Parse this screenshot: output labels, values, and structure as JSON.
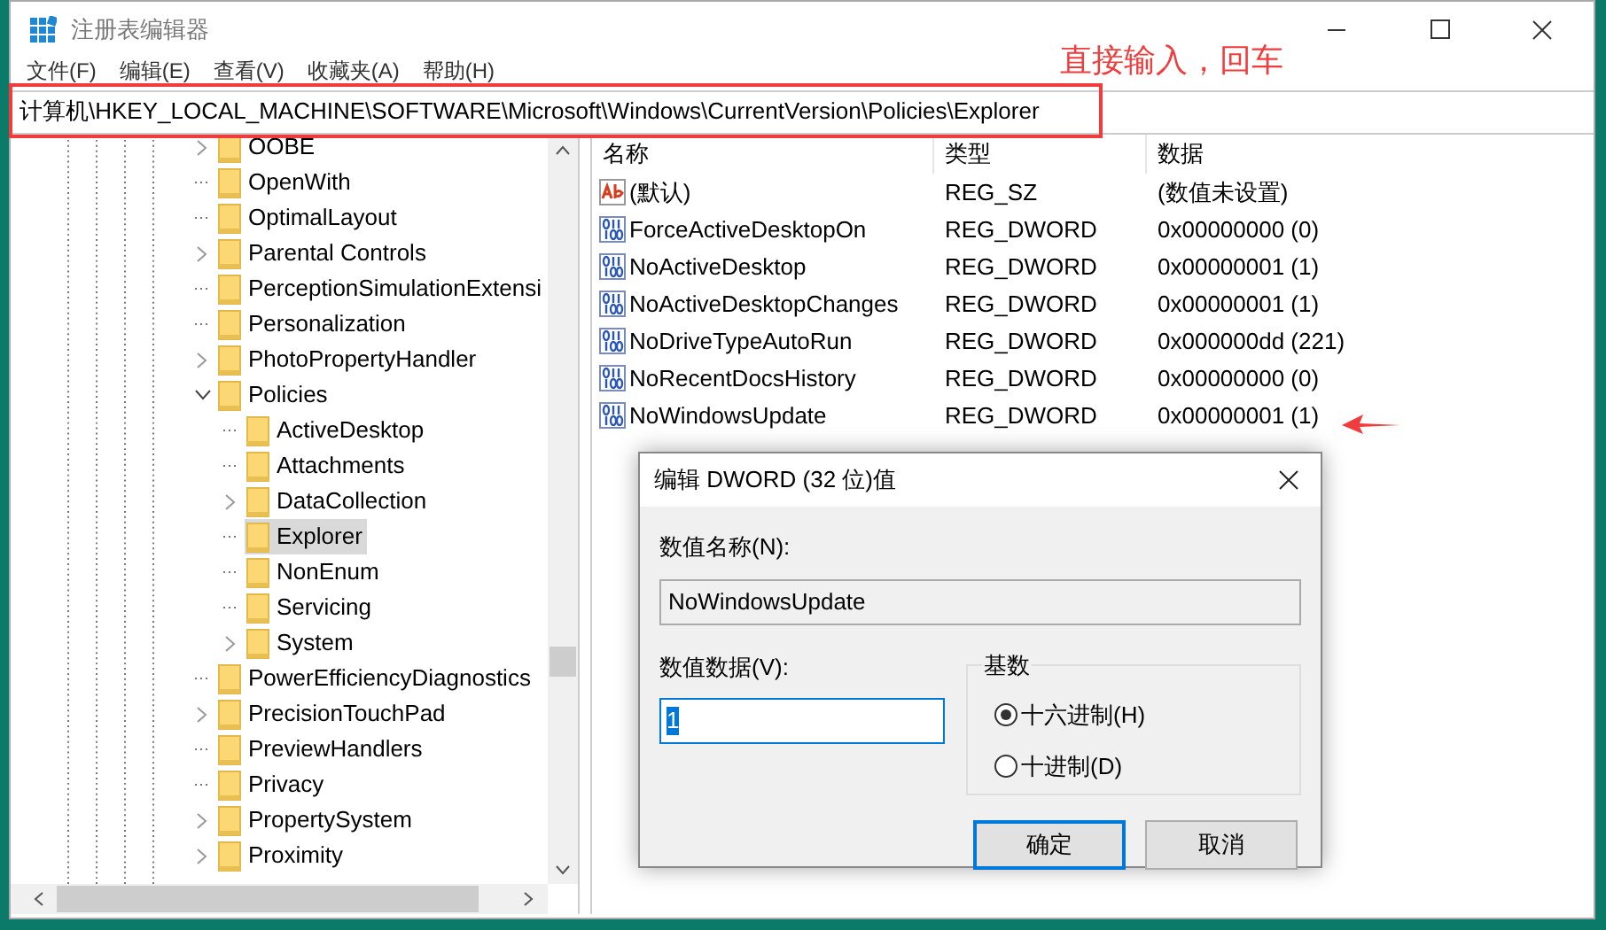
{
  "window": {
    "title": "注册表编辑器"
  },
  "menu": [
    {
      "label": "文件(F)"
    },
    {
      "label": "编辑(E)"
    },
    {
      "label": "查看(V)"
    },
    {
      "label": "收藏夹(A)"
    },
    {
      "label": "帮助(H)"
    }
  ],
  "address": "计算机\\HKEY_LOCAL_MACHINE\\SOFTWARE\\Microsoft\\Windows\\CurrentVersion\\Policies\\Explorer",
  "annotation": "直接输入，回车",
  "tree": [
    {
      "label": "OOBE",
      "expandable": true,
      "expanded": false,
      "selected": false
    },
    {
      "label": "OpenWith",
      "expandable": false,
      "expanded": false,
      "selected": false
    },
    {
      "label": "OptimalLayout",
      "expandable": false,
      "expanded": false,
      "selected": false
    },
    {
      "label": "Parental Controls",
      "expandable": true,
      "expanded": false,
      "selected": false
    },
    {
      "label": "PerceptionSimulationExtensi",
      "expandable": false,
      "expanded": false,
      "selected": false
    },
    {
      "label": "Personalization",
      "expandable": false,
      "expanded": false,
      "selected": false
    },
    {
      "label": "PhotoPropertyHandler",
      "expandable": true,
      "expanded": false,
      "selected": false
    },
    {
      "label": "Policies",
      "expandable": true,
      "expanded": true,
      "selected": false,
      "children": [
        {
          "label": "ActiveDesktop",
          "expandable": false,
          "expanded": false,
          "selected": false
        },
        {
          "label": "Attachments",
          "expandable": false,
          "expanded": false,
          "selected": false
        },
        {
          "label": "DataCollection",
          "expandable": true,
          "expanded": false,
          "selected": false
        },
        {
          "label": "Explorer",
          "expandable": false,
          "expanded": false,
          "selected": true
        },
        {
          "label": "NonEnum",
          "expandable": false,
          "expanded": false,
          "selected": false
        },
        {
          "label": "Servicing",
          "expandable": false,
          "expanded": false,
          "selected": false
        },
        {
          "label": "System",
          "expandable": true,
          "expanded": false,
          "selected": false
        }
      ]
    },
    {
      "label": "PowerEfficiencyDiagnostics",
      "expandable": false,
      "expanded": false,
      "selected": false
    },
    {
      "label": "PrecisionTouchPad",
      "expandable": true,
      "expanded": false,
      "selected": false
    },
    {
      "label": "PreviewHandlers",
      "expandable": false,
      "expanded": false,
      "selected": false
    },
    {
      "label": "Privacy",
      "expandable": false,
      "expanded": false,
      "selected": false
    },
    {
      "label": "PropertySystem",
      "expandable": true,
      "expanded": false,
      "selected": false
    },
    {
      "label": "Proximity",
      "expandable": true,
      "expanded": false,
      "selected": false
    }
  ],
  "values": {
    "columns": [
      "名称",
      "类型",
      "数据"
    ],
    "rows": [
      {
        "kind": "string",
        "name": "(默认)",
        "type": "REG_SZ",
        "data": "(数值未设置)"
      },
      {
        "kind": "binary",
        "name": "ForceActiveDesktopOn",
        "type": "REG_DWORD",
        "data": "0x00000000 (0)"
      },
      {
        "kind": "binary",
        "name": "NoActiveDesktop",
        "type": "REG_DWORD",
        "data": "0x00000001 (1)"
      },
      {
        "kind": "binary",
        "name": "NoActiveDesktopChanges",
        "type": "REG_DWORD",
        "data": "0x00000001 (1)"
      },
      {
        "kind": "binary",
        "name": "NoDriveTypeAutoRun",
        "type": "REG_DWORD",
        "data": "0x000000dd (221)"
      },
      {
        "kind": "binary",
        "name": "NoRecentDocsHistory",
        "type": "REG_DWORD",
        "data": "0x00000000 (0)"
      },
      {
        "kind": "binary",
        "name": "NoWindowsUpdate",
        "type": "REG_DWORD",
        "data": "0x00000001 (1)"
      }
    ]
  },
  "dialog": {
    "title": "编辑 DWORD (32 位)值",
    "name_label": "数值名称(N):",
    "name_value": "NoWindowsUpdate",
    "data_label": "数值数据(V):",
    "data_value": "1",
    "base_label": "基数",
    "bases": [
      {
        "label": "十六进制(H)",
        "selected": true
      },
      {
        "label": "十进制(D)",
        "selected": false
      }
    ],
    "buttons": [
      {
        "label": "确定",
        "default": true
      },
      {
        "label": "取消",
        "default": false
      }
    ]
  }
}
